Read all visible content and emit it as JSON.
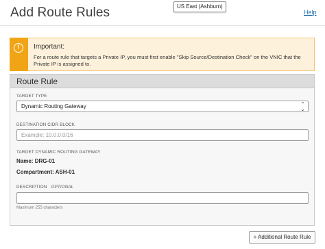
{
  "header": {
    "title": "Add Route Rules",
    "region": "US East (Ashburn)",
    "help_label": "Help"
  },
  "alert": {
    "icon": "info-circle-icon",
    "title": "Important:",
    "message": "For a route rule that targets a Private IP, you must first enable \"Skip Source/Destination Check\" on the VNIC that the Private IP is assigned to."
  },
  "route_rule": {
    "panel_title": "Route Rule",
    "target_type": {
      "label": "TARGET TYPE",
      "value": "Dynamic Routing Gateway"
    },
    "destination_cidr": {
      "label": "DESTINATION CIDR BLOCK",
      "placeholder": "Example: 10.0.0.0/16",
      "value": ""
    },
    "target_drg": {
      "label": "TARGET DYNAMIC ROUTING GATEWAY",
      "name_label": "Name:",
      "name_value": "DRG-01",
      "compartment_label": "Compartment:",
      "compartment_value": "ASH-01"
    },
    "description": {
      "label": "DESCRIPTION",
      "optional_label": "OPTIONAL",
      "value": "",
      "hint": "Maximum 255 characters"
    }
  },
  "actions": {
    "add_rule_label": "+ Additional Route Rule"
  },
  "colors": {
    "alert_accent": "#f1a516",
    "alert_background": "#fdf1db",
    "link": "#1f6fb2",
    "panel_header": "#dcdcdc"
  }
}
